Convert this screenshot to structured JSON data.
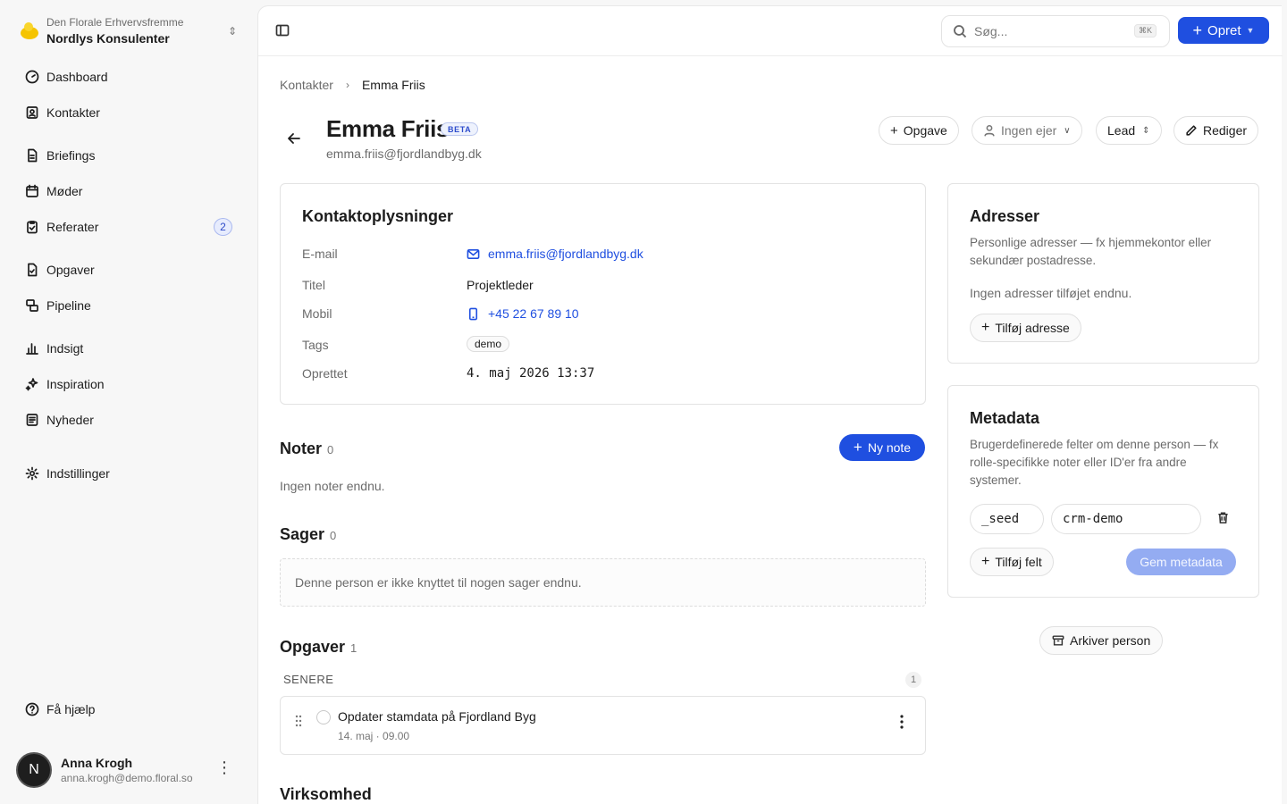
{
  "workspace": {
    "org": "Den Florale Erhvervsfremme",
    "name": "Nordlys Konsulenter"
  },
  "nav": [
    {
      "label": "Dashboard",
      "icon": "gauge-icon"
    },
    {
      "label": "Kontakter",
      "icon": "contacts-icon"
    },
    {
      "label": "Briefings",
      "icon": "document-icon"
    },
    {
      "label": "Møder",
      "icon": "calendar-icon"
    },
    {
      "label": "Referater",
      "icon": "clipboard-icon",
      "badge": "2"
    },
    {
      "label": "Opgaver",
      "icon": "tasks-icon"
    },
    {
      "label": "Pipeline",
      "icon": "pipeline-icon"
    },
    {
      "label": "Indsigt",
      "icon": "chart-icon"
    },
    {
      "label": "Inspiration",
      "icon": "sparkles-icon"
    },
    {
      "label": "Nyheder",
      "icon": "newspaper-icon"
    },
    {
      "label": "Indstillinger",
      "icon": "gear-icon"
    }
  ],
  "help": {
    "label": "Få hjælp"
  },
  "user": {
    "initial": "N",
    "name": "Anna Krogh",
    "email": "anna.krogh@demo.floral.so"
  },
  "topbar": {
    "search_placeholder": "Søg...",
    "search_shortcut": "⌘K",
    "create_label": "Opret"
  },
  "breadcrumb": {
    "parent": "Kontakter",
    "current": "Emma Friis"
  },
  "person": {
    "name": "Emma Friis",
    "badge": "BETA",
    "email": "emma.friis@fjordlandbyg.dk"
  },
  "actions": {
    "task": "Opgave",
    "owner": "Ingen ejer",
    "stage": "Lead",
    "edit": "Rediger"
  },
  "contact_info": {
    "title": "Kontaktoplysninger",
    "rows": [
      {
        "label": "E-mail",
        "value": "emma.friis@fjordlandbyg.dk"
      },
      {
        "label": "Titel",
        "value": "Projektleder"
      },
      {
        "label": "Mobil",
        "value": "+45 22 67 89 10"
      },
      {
        "label": "Tags",
        "value": "demo"
      },
      {
        "label": "Oprettet",
        "value": "4. maj 2026 13:37"
      }
    ]
  },
  "notes": {
    "title": "Noter",
    "count": "0",
    "new_label": "Ny note",
    "empty": "Ingen noter endnu."
  },
  "cases": {
    "title": "Sager",
    "count": "0",
    "empty": "Denne person er ikke knyttet til nogen sager endnu."
  },
  "tasks": {
    "title": "Opgaver",
    "count": "1",
    "group_label": "SENERE",
    "group_count": "1",
    "items": [
      {
        "title": "Opdater stamdata på Fjordland Byg",
        "date": "14. maj · 09.00"
      }
    ]
  },
  "company": {
    "title": "Virksomhed"
  },
  "addresses": {
    "title": "Adresser",
    "description": "Personlige adresser — fx hjemmekontor eller sekundær postadresse.",
    "empty": "Ingen adresser tilføjet endnu.",
    "add_label": "Tilføj adresse"
  },
  "metadata": {
    "title": "Metadata",
    "description": "Brugerdefinerede felter om denne person — fx rolle-specifikke noter eller ID'er fra andre systemer.",
    "fields": [
      {
        "key": "_seed",
        "value": "crm-demo"
      }
    ],
    "add_label": "Tilføj felt",
    "save_label": "Gem metadata"
  },
  "archive_label": "Arkiver person",
  "colors": {
    "accent": "#1f4fe0",
    "accent_disabled": "#94acf2",
    "background": "#f7f7f7"
  }
}
